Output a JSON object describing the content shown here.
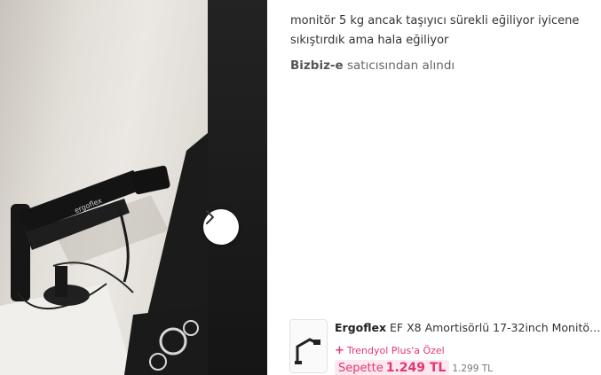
{
  "review": {
    "text": "monitör 5 kg ancak taşıyıcı sürekli eğiliyor iyicene sıkıştırdık ama hala eğiliyor",
    "seller_name": "Bizbiz-e",
    "seller_suffix": " satıcısından alındı"
  },
  "photo": {
    "logo_text": "ergoflex",
    "next_icon": "chevron-right-icon"
  },
  "product": {
    "brand": "Ergoflex",
    "title": " EF X8 Amortisörlü 17-32inch Monitör Kol...",
    "plus_icon": "plus-icon",
    "plus_label": "Trendyol Plus'a Özel",
    "sepette_label": "Sepette",
    "sepette_price": "1.249 TL",
    "old_price": "1.299 TL"
  },
  "colors": {
    "accent_pink": "#e6356f",
    "sepette_bg": "#fde8ef"
  }
}
